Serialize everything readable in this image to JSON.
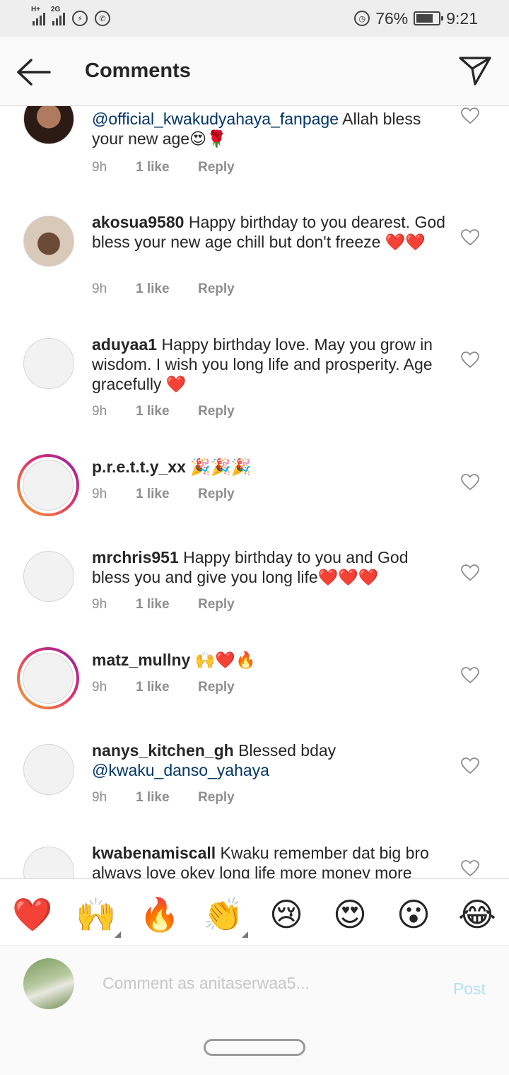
{
  "status_bar": {
    "network_1": "H+",
    "network_2": "2G",
    "battery": "76%",
    "time": "9:21",
    "icons": [
      "signal-icon",
      "messenger-icon",
      "whatsapp-icon",
      "alarm-icon",
      "battery-icon"
    ]
  },
  "header": {
    "title": "Comments",
    "back_icon": "arrow-left-icon",
    "send_icon": "paper-plane-icon"
  },
  "comments": [
    {
      "username": "",
      "mention": "@official_kwakudyahaya_fanpage",
      "text_after": " Allah bless your new age😍🌹",
      "time": "9h",
      "likes": "1 like",
      "reply": "Reply"
    },
    {
      "username": "akosua9580",
      "text": " Happy birthday to you dearest. God bless your new age chill but don't freeze ❤️❤️",
      "time": "9h",
      "likes": "1 like",
      "reply": "Reply"
    },
    {
      "username": "aduyaa1",
      "text": " Happy birthday love. May you grow in wisdom. I wish you long life and prosperity. Age gracefully ❤️",
      "time": "9h",
      "likes": "1 like",
      "reply": "Reply"
    },
    {
      "username": "p.r.e.t.t.y_xx",
      "text": " 🎉🎉🎉",
      "time": "9h",
      "likes": "1 like",
      "reply": "Reply"
    },
    {
      "username": "mrchris951",
      "text": " Happy birthday to you and God bless you and give you long life❤️❤️❤️",
      "time": "9h",
      "likes": "1 like",
      "reply": "Reply"
    },
    {
      "username": "matz_mullny",
      "text": " 🙌❤️🔥",
      "time": "9h",
      "likes": "1 like",
      "reply": "Reply"
    },
    {
      "username": "nanys_kitchen_gh",
      "text": " Blessed bday ",
      "mention": "@kwaku_danso_yahaya",
      "time": "9h",
      "likes": "1 like",
      "reply": "Reply"
    },
    {
      "username": "kwabenamiscall",
      "text": " Kwaku remember dat big bro always love okey long life more money more"
    }
  ],
  "emoji_bar": [
    "❤️",
    "🙌",
    "🔥",
    "👏",
    "😢",
    "😍",
    "😮",
    "😂"
  ],
  "composer": {
    "placeholder": "Comment as anitaserwaa5...",
    "post_label": "Post"
  }
}
